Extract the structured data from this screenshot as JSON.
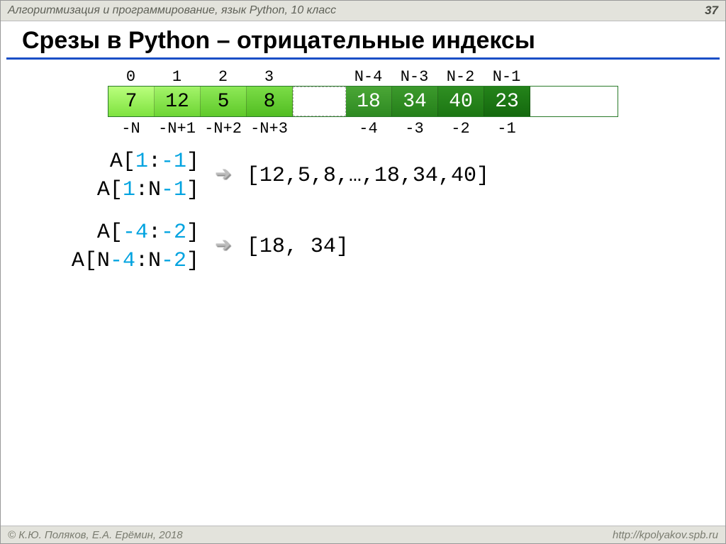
{
  "header": {
    "course": "Алгоритмизация и программирование, язык Python, 10 класс",
    "page": "37"
  },
  "title": "Срезы в Python – отрицательные индексы",
  "indices": {
    "top": [
      "0",
      "1",
      "2",
      "3",
      "N-4",
      "N-3",
      "N-2",
      "N-1"
    ],
    "bottom": [
      "-N",
      "-N+1",
      "-N+2",
      "-N+3",
      "-4",
      "-3",
      "-2",
      "-1"
    ]
  },
  "cells": {
    "left": [
      "7",
      "12",
      "5",
      "8"
    ],
    "right": [
      "18",
      "34",
      "40",
      "23"
    ]
  },
  "ex1": {
    "line1": {
      "p1": "A[",
      "p2": "1",
      "p3": ":",
      "p4": "-1",
      "p5": "]"
    },
    "line2": {
      "p1": "A[",
      "p2": "1",
      "p3": ":N",
      "p4": "-1",
      "p5": "]"
    },
    "result": "[12,5,8,…,18,34,40]"
  },
  "ex2": {
    "line1": {
      "p1": "A[",
      "p2": "-4",
      "p3": ":",
      "p4": "-2",
      "p5": "]"
    },
    "line2": {
      "p1": "A[N",
      "p2": "-4",
      "p3": ":N",
      "p4": "-2",
      "p5": "]"
    },
    "result": "[18, 34]"
  },
  "footer": {
    "left": "© К.Ю. Поляков, Е.А. Ерёмин, 2018",
    "right": "http://kpolyakov.spb.ru"
  }
}
